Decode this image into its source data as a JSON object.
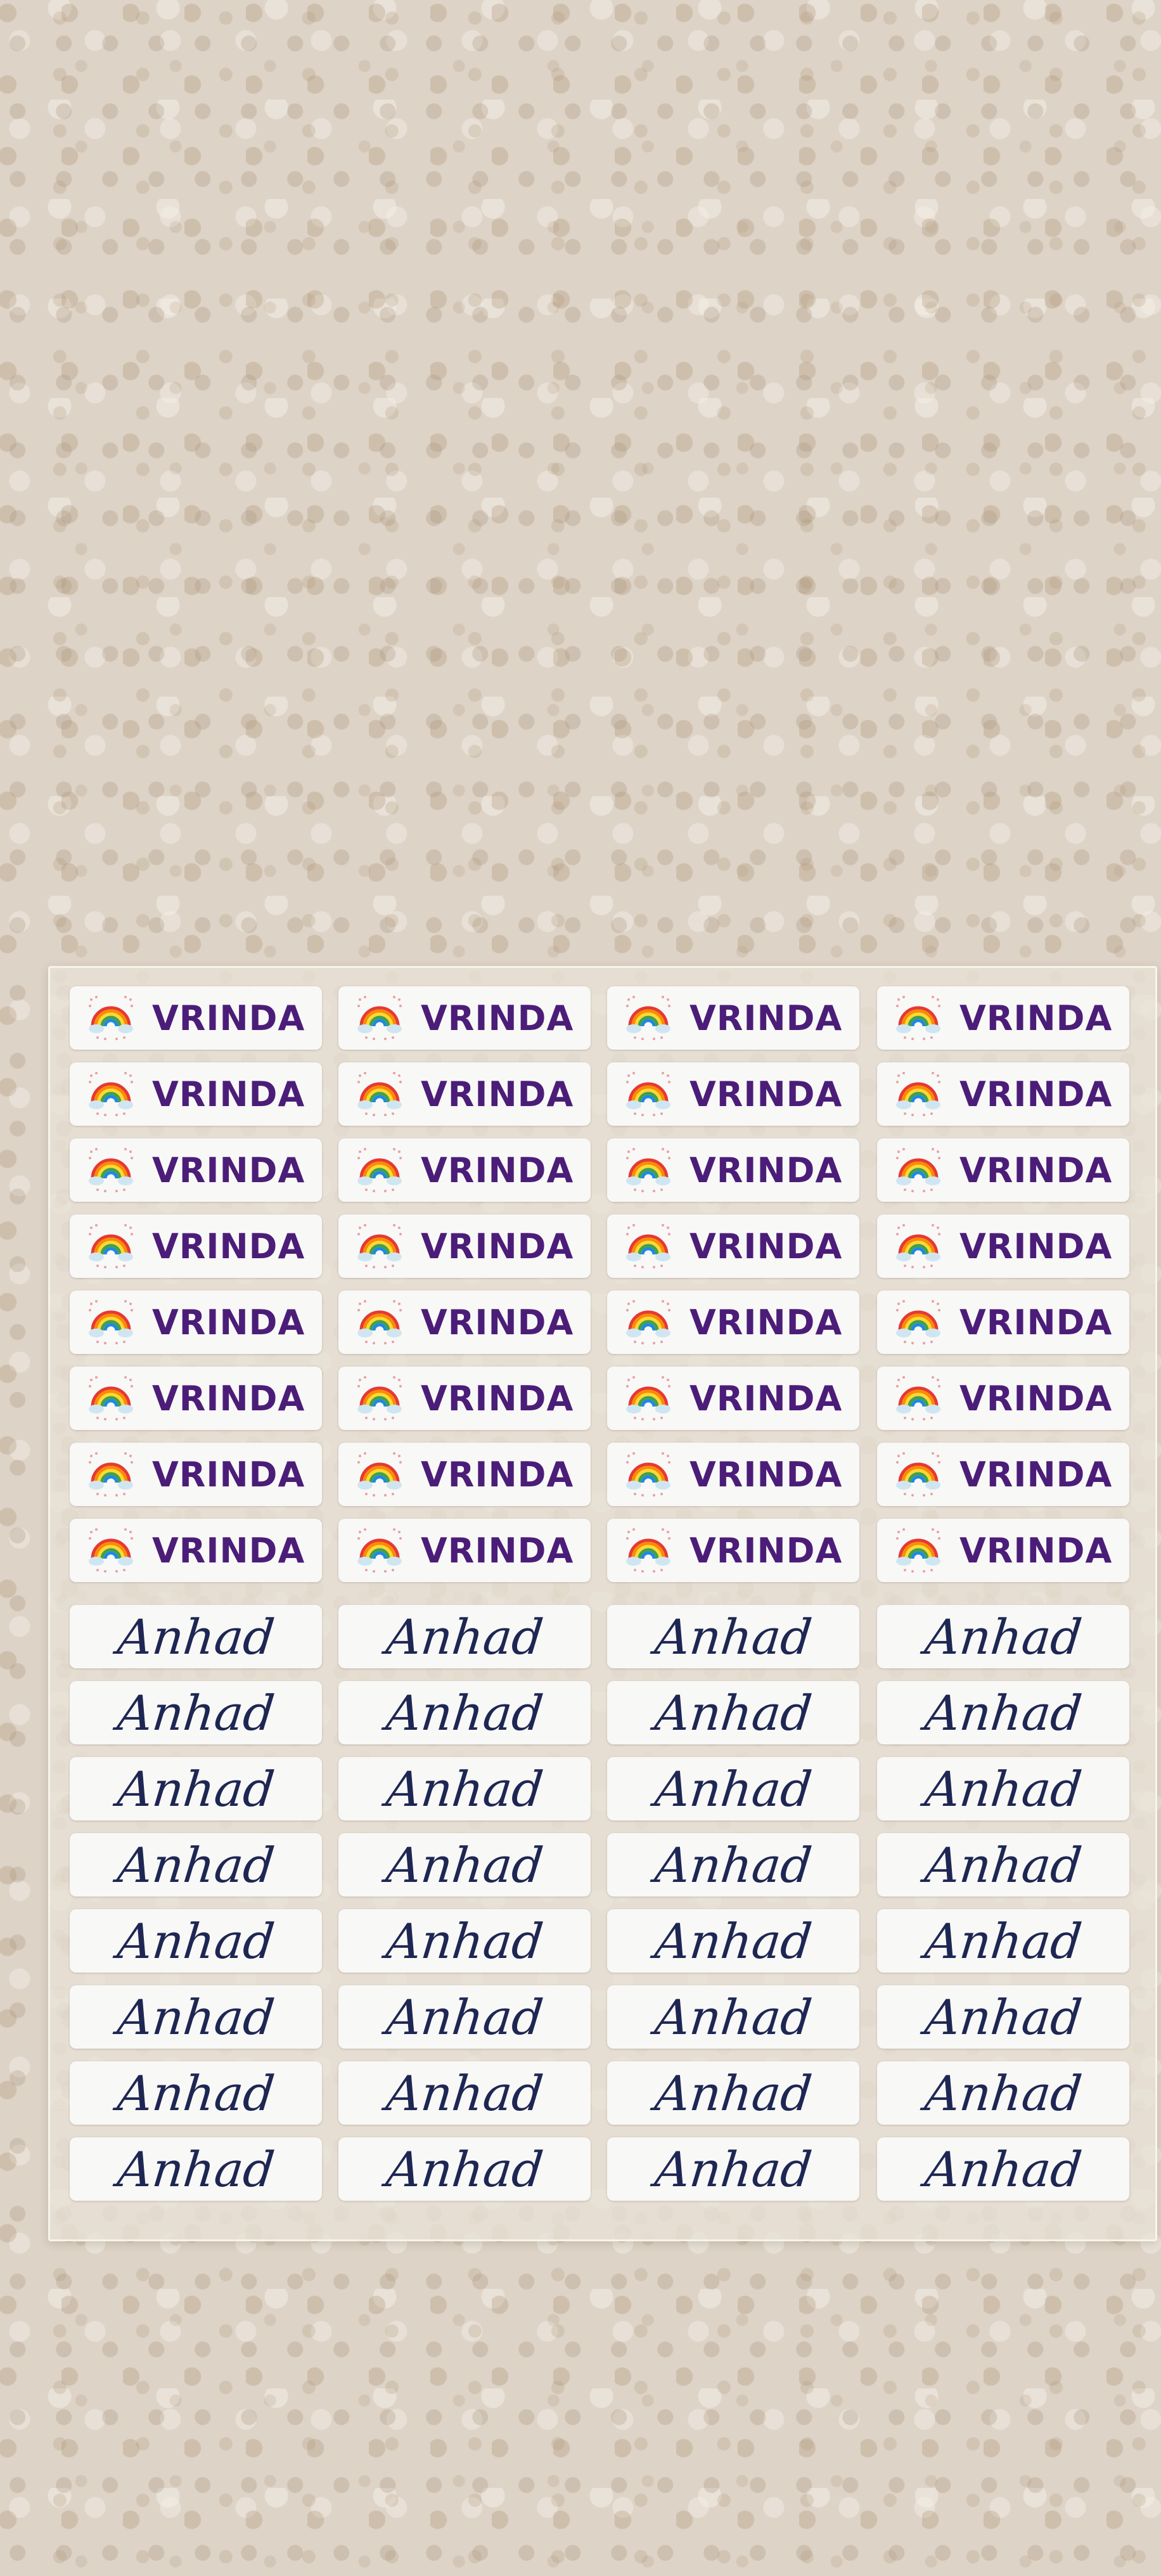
{
  "scene": {
    "background": "beige textured wall",
    "sheet": "sheet of printed name labels"
  },
  "labels": {
    "vrinda": {
      "text": "VRINDA",
      "icon": "rainbow-icon",
      "text_color": "#4b1d78",
      "rows": 8,
      "columns": 4
    },
    "anhad": {
      "text": "Anhad",
      "text_color": "#1e2653",
      "rows": 8,
      "columns": 4
    }
  }
}
